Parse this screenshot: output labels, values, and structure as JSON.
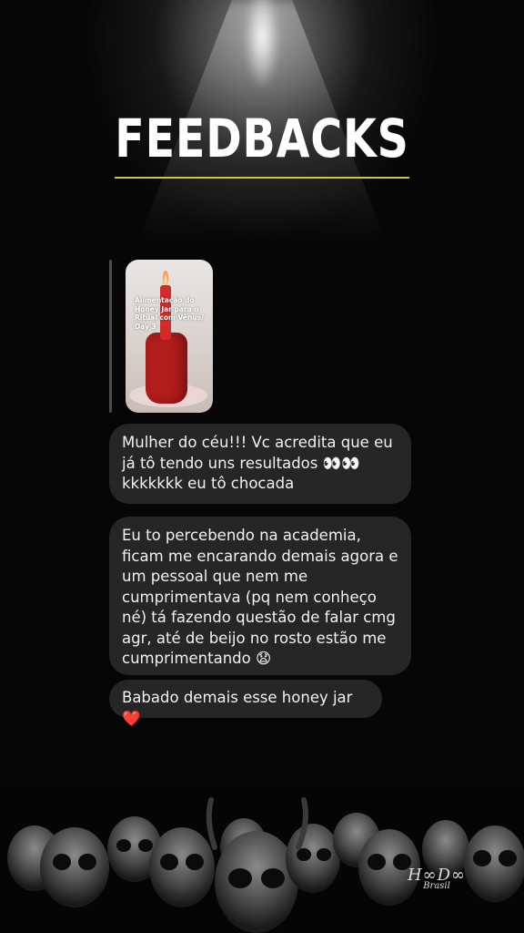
{
  "header": {
    "title": "FEEDBACKS"
  },
  "story_reply": {
    "caption": "Alimentação do Honey Jar para o Ritual com Vênus/ Day 3"
  },
  "messages": [
    {
      "text": "Mulher do céu!!! Vc acredita que eu já tô tendo uns resultados 👀👀 kkkkkkk eu tô chocada"
    },
    {
      "text": "Eu to percebendo na academia, ficam me encarando demais agora e um pessoal que nem me cumprimentava (pq nem conheço né) tá fazendo questão de falar cmg agr, até de beijo no rosto estão me cumprimentando 😧"
    },
    {
      "text": "Babado demais esse honey jar ❤️"
    }
  ],
  "brand": {
    "name": "Hoodoo",
    "sub": "Brasil"
  },
  "colors": {
    "background": "#050505",
    "accent_rule": "#d8c23a",
    "bubble": "#262626"
  }
}
